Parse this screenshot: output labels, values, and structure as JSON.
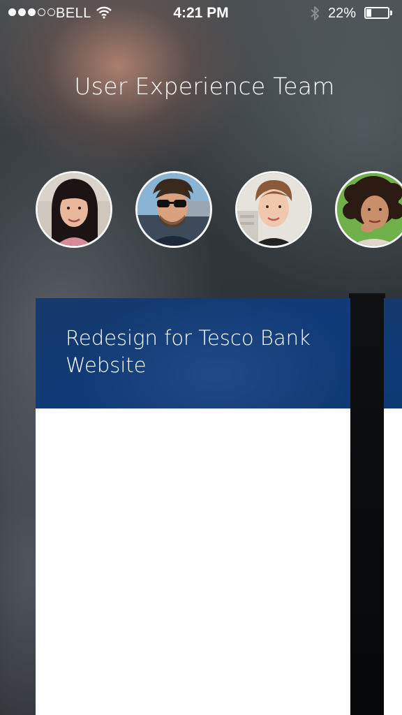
{
  "status_bar": {
    "carrier": "BELL",
    "time": "4:21 PM",
    "battery_percent": "22%",
    "signal_bars_filled": 3,
    "signal_bars_total": 5,
    "battery_level": 0.22,
    "icons": [
      "wifi-icon",
      "bluetooth-icon",
      "battery-icon"
    ]
  },
  "header": {
    "title": "User Experience Team"
  },
  "team_members": [
    {
      "avatar": "avatar-woman-dark-hair"
    },
    {
      "avatar": "avatar-man-sunglasses"
    },
    {
      "avatar": "avatar-woman-updo"
    },
    {
      "avatar": "avatar-woman-curly-hair"
    }
  ],
  "projects": [
    {
      "title": "Redesign for Tesco Bank Website"
    }
  ],
  "colors": {
    "card_header": "#0f3b78",
    "card_body": "#ffffff",
    "text": "#ffffff"
  }
}
